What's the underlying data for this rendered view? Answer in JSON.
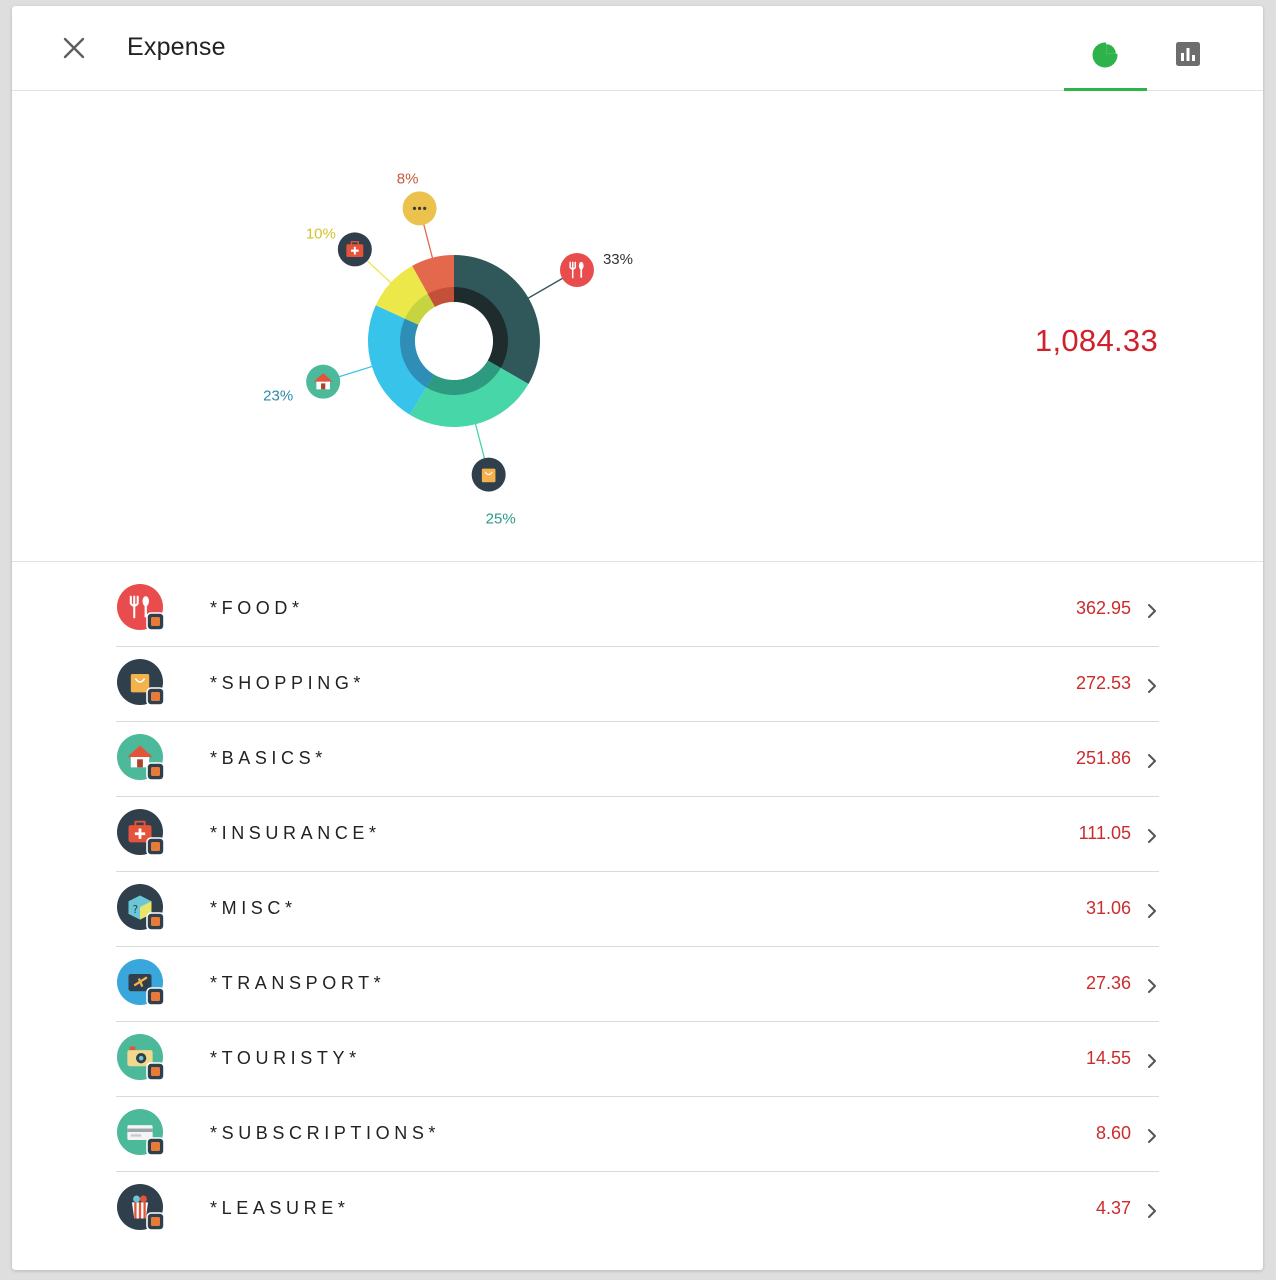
{
  "header": {
    "title": "Expense",
    "close_icon": "close-icon",
    "tabs": [
      {
        "id": "pie",
        "icon": "pie-chart-icon",
        "active": true
      },
      {
        "id": "bar",
        "icon": "bar-chart-icon",
        "active": false
      }
    ]
  },
  "colors": {
    "accent": "#2db34a",
    "amount": "#cc2b2b",
    "total": "#d0202a"
  },
  "summary": {
    "total": "1,084.33"
  },
  "chart_data": {
    "type": "pie",
    "variant": "donut",
    "categories": [
      "Food",
      "Shopping",
      "Basics",
      "Insurance",
      "Other"
    ],
    "values": [
      33,
      25,
      23,
      10,
      8
    ],
    "labels": [
      "33%",
      "25%",
      "23%",
      "10%",
      "8%"
    ],
    "colors": [
      "#30585a",
      "#47d6a8",
      "#38c3ea",
      "#ece84a",
      "#e4684c"
    ],
    "inner_colors": [
      "#1f2c2d",
      "#2e9a80",
      "#2f8eb5",
      "#c6d53f",
      "#c3513a"
    ],
    "label_colors": [
      "#333333",
      "#2a9b88",
      "#2c8aa8",
      "#cfc52b",
      "#c65a3a"
    ],
    "icons": [
      "food-icon",
      "shopping-icon",
      "basics-icon",
      "insurance-icon",
      "more-icon"
    ]
  },
  "categories": [
    {
      "name": "*FOOD*",
      "amount": "362.95",
      "icon": "food-icon",
      "color": "#e84c4c"
    },
    {
      "name": "*SHOPPING*",
      "amount": "272.53",
      "icon": "shopping-icon",
      "color": "#2f3f4c"
    },
    {
      "name": "*BASICS*",
      "amount": "251.86",
      "icon": "basics-icon",
      "color": "#4bb99a"
    },
    {
      "name": "*INSURANCE*",
      "amount": "111.05",
      "icon": "insurance-icon",
      "color": "#2f3f4c"
    },
    {
      "name": "*MISC*",
      "amount": "31.06",
      "icon": "misc-icon",
      "color": "#2f3f4c"
    },
    {
      "name": "*TRANSPORT*",
      "amount": "27.36",
      "icon": "transport-icon",
      "color": "#3aa7dc"
    },
    {
      "name": "*TOURISTY*",
      "amount": "14.55",
      "icon": "touristy-icon",
      "color": "#4bb99a"
    },
    {
      "name": "*SUBSCRIPTIONS*",
      "amount": "8.60",
      "icon": "subscriptions-icon",
      "color": "#4bb99a"
    },
    {
      "name": "*LEASURE*",
      "amount": "4.37",
      "icon": "leasure-icon",
      "color": "#2f3f4c"
    }
  ]
}
